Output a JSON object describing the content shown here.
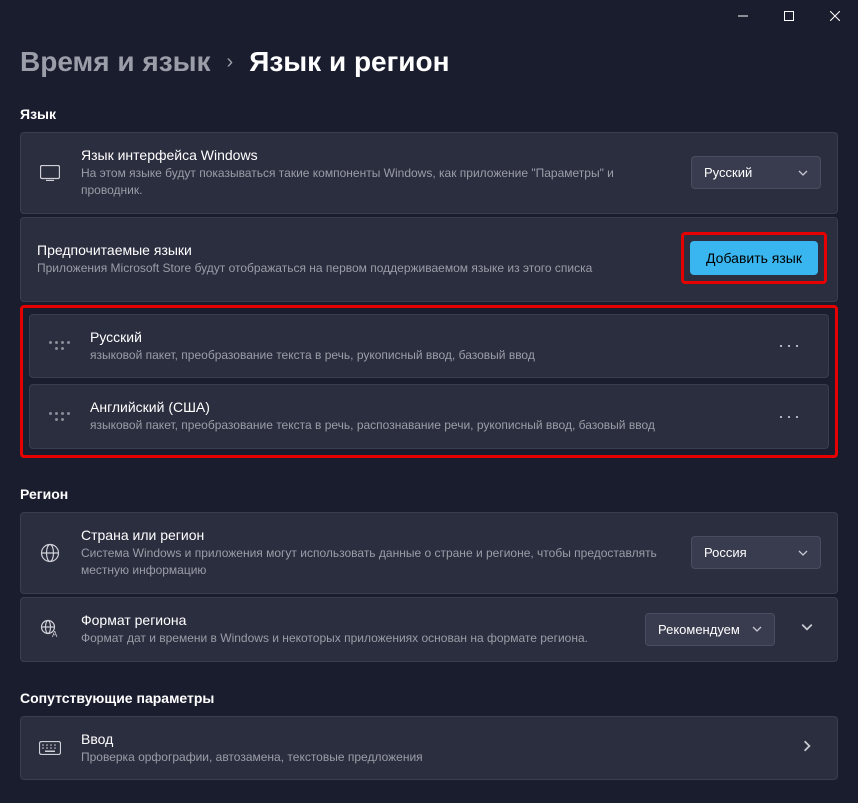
{
  "breadcrumb": {
    "parent": "Время и язык",
    "current": "Язык и регион"
  },
  "sections": {
    "language": "Язык",
    "region": "Регион",
    "related": "Сопутствующие параметры"
  },
  "display_language": {
    "title": "Язык интерфейса Windows",
    "desc": "На этом языке будут показываться такие компоненты Windows, как приложение \"Параметры\" и проводник.",
    "selected": "Русский"
  },
  "preferred": {
    "title": "Предпочитаемые языки",
    "desc": "Приложения Microsoft Store будут отображаться на первом поддерживаемом языке из этого списка",
    "add_button": "Добавить язык"
  },
  "languages": [
    {
      "name": "Русский",
      "features": "языковой пакет, преобразование текста в речь, рукописный ввод, базовый ввод"
    },
    {
      "name": "Английский (США)",
      "features": "языковой пакет, преобразование текста в речь, распознавание речи, рукописный ввод, базовый ввод"
    }
  ],
  "country": {
    "title": "Страна или регион",
    "desc": "Система Windows и приложения могут использовать данные о стране и регионе, чтобы предоставлять местную информацию",
    "selected": "Россия"
  },
  "format": {
    "title": "Формат региона",
    "desc": "Формат дат и времени в Windows и некоторых приложениях основан на формате региона.",
    "selected": "Рекомендуем"
  },
  "input": {
    "title": "Ввод",
    "desc": "Проверка орфографии, автозамена, текстовые предложения"
  }
}
